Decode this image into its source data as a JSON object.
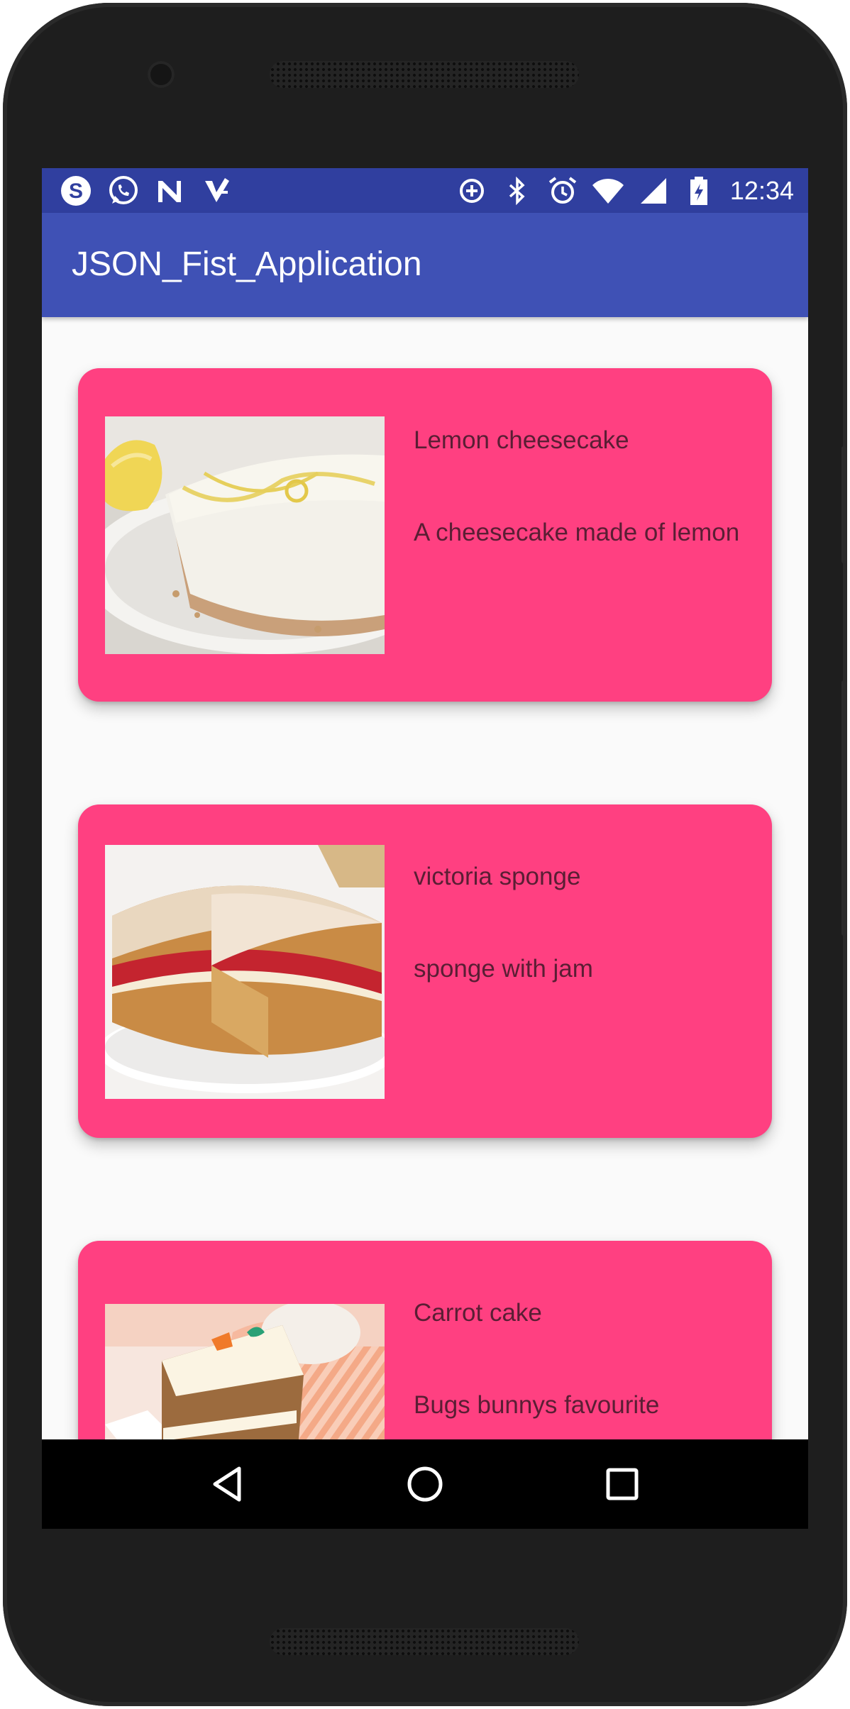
{
  "status_bar": {
    "left_icons": [
      "skype-icon",
      "whatsapp-icon",
      "n-icon",
      "tasks-icon"
    ],
    "right_icons": [
      "data-saver-icon",
      "bluetooth-icon",
      "alarm-icon",
      "wifi-icon",
      "signal-icon",
      "battery-icon"
    ],
    "time": "12:34",
    "background": "#303f9f"
  },
  "app_bar": {
    "title": "JSON_Fist_Application",
    "background": "#3f51b5"
  },
  "items": [
    {
      "title": "Lemon cheesecake",
      "description": "A cheesecake made of lemon",
      "image": "lemon-cheesecake-image"
    },
    {
      "title": "victoria sponge",
      "description": "sponge with jam",
      "image": "victoria-sponge-image"
    },
    {
      "title": "Carrot cake",
      "description": "Bugs bunnys favourite",
      "image": "carrot-cake-image"
    }
  ],
  "colors": {
    "card": "#ff4081",
    "card_text": "#5a1e34",
    "screen_background": "#fafafa"
  },
  "nav_bar": {
    "buttons": [
      "back-icon",
      "home-icon",
      "recents-icon"
    ]
  }
}
